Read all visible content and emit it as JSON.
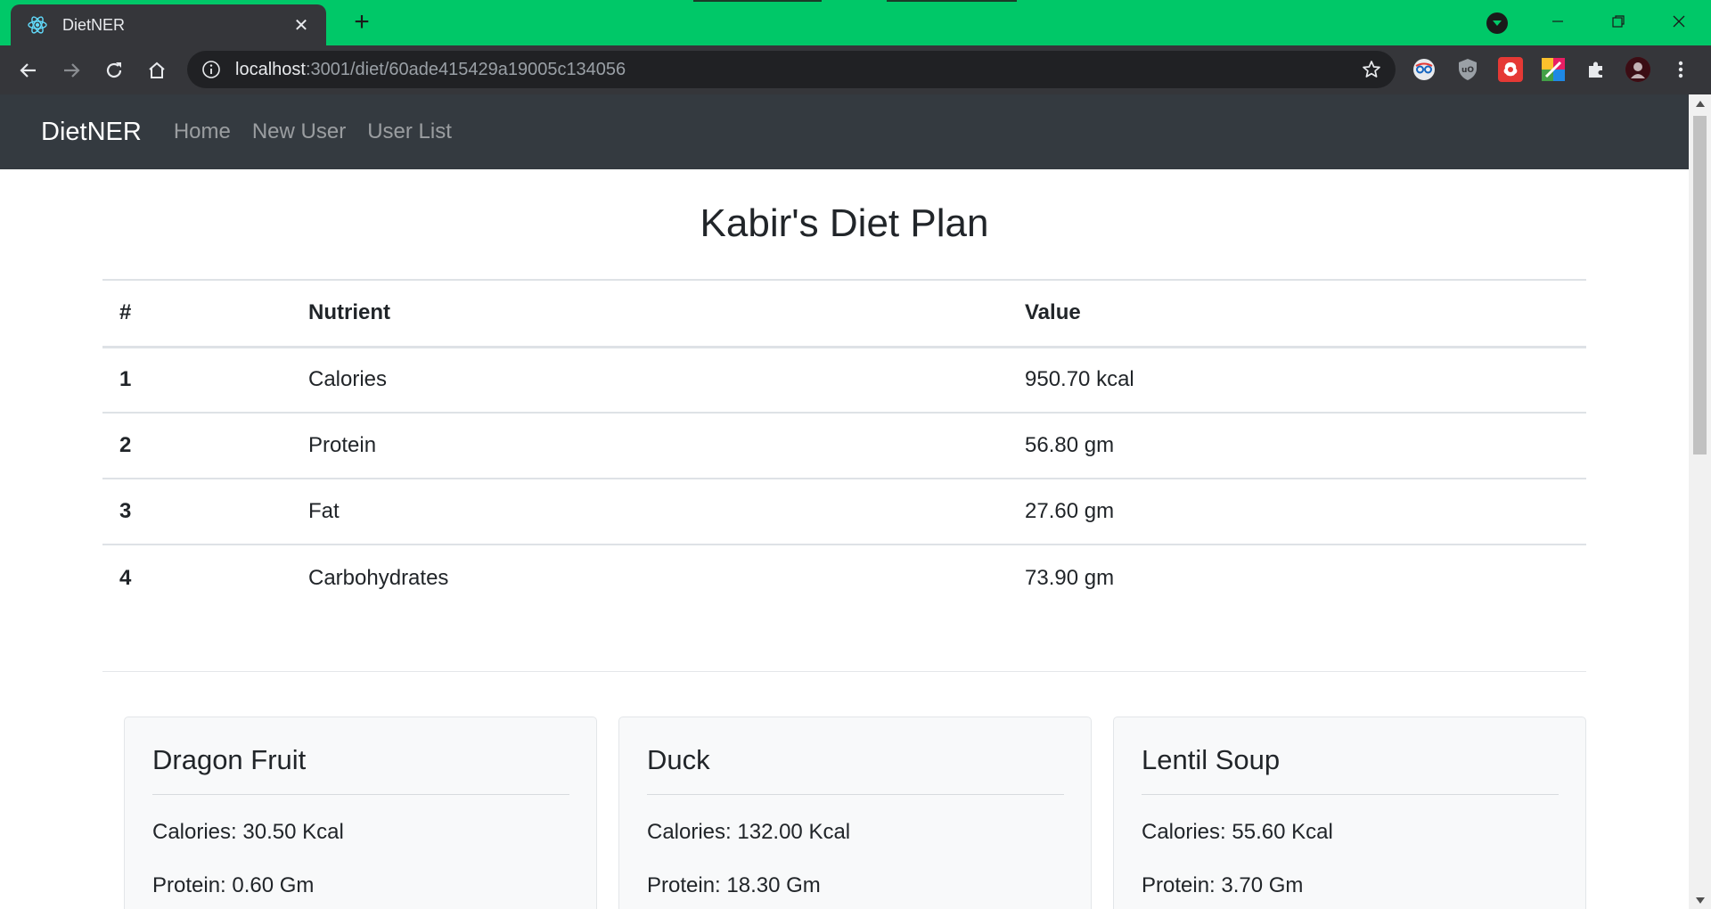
{
  "browser": {
    "tab_title": "DietNER",
    "url_host": "localhost",
    "url_path": ":3001/diet/60ade415429a19005c134056"
  },
  "navbar": {
    "brand": "DietNER",
    "links": [
      "Home",
      "New User",
      "User List"
    ]
  },
  "page": {
    "title": "Kabir's Diet Plan"
  },
  "nutrient_table": {
    "headers": [
      "#",
      "Nutrient",
      "Value"
    ],
    "rows": [
      {
        "index": "1",
        "nutrient": "Calories",
        "value": "950.70 kcal"
      },
      {
        "index": "2",
        "nutrient": "Protein",
        "value": "56.80 gm"
      },
      {
        "index": "3",
        "nutrient": "Fat",
        "value": "27.60 gm"
      },
      {
        "index": "4",
        "nutrient": "Carbohydrates",
        "value": "73.90 gm"
      }
    ]
  },
  "foods": [
    {
      "name": "Dragon Fruit",
      "calories": "Calories: 30.50 Kcal",
      "protein": "Protein: 0.60 Gm"
    },
    {
      "name": "Duck",
      "calories": "Calories: 132.00 Kcal",
      "protein": "Protein: 18.30 Gm"
    },
    {
      "name": "Lentil Soup",
      "calories": "Calories: 55.60 Kcal",
      "protein": "Protein: 3.70 Gm"
    }
  ],
  "colors": {
    "tabbar_accent": "#00c868",
    "navbar_bg": "#343a40",
    "card_bg": "#f8f9fa"
  },
  "icons": {
    "favicon": "react-atom-icon",
    "back": "arrow-left-icon",
    "forward": "arrow-right-icon",
    "reload": "reload-icon",
    "home": "home-icon",
    "site_info": "info-circle-icon",
    "bookmark": "star-icon",
    "extensions": "puzzle-icon",
    "menu": "kebab-menu-icon"
  }
}
